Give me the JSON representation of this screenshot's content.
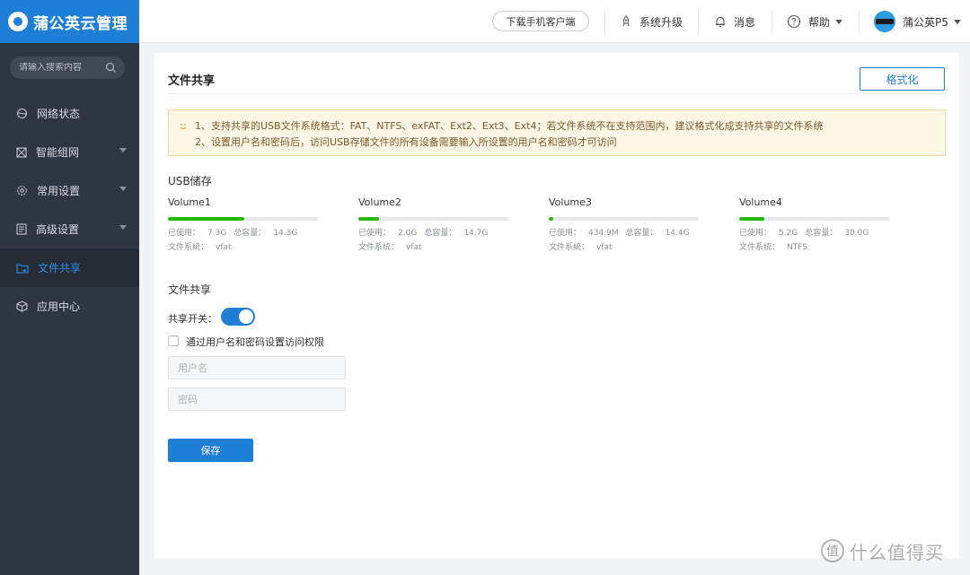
{
  "header": {
    "brand": "蒲公英云管理",
    "download_client": "下载手机客户端",
    "upgrade": "系统升级",
    "messages": "消息",
    "help": "帮助",
    "device": "蒲公英P5"
  },
  "sidebar": {
    "search_placeholder": "请输入搜索内容",
    "items": [
      {
        "label": "网络状态",
        "icon": "globe-icon",
        "expandable": false,
        "active": false
      },
      {
        "label": "智能组网",
        "icon": "network-icon",
        "expandable": true,
        "active": false
      },
      {
        "label": "常用设置",
        "icon": "gear-icon",
        "expandable": true,
        "active": false
      },
      {
        "label": "高级设置",
        "icon": "document-icon",
        "expandable": true,
        "active": false
      },
      {
        "label": "文件共享",
        "icon": "folder-share-icon",
        "expandable": false,
        "active": true
      },
      {
        "label": "应用中心",
        "icon": "cube-icon",
        "expandable": false,
        "active": false
      }
    ]
  },
  "main": {
    "title": "文件共享",
    "format_button": "格式化",
    "notice": [
      "1、支持共享的USB文件系统格式：FAT、NTFS、exFAT、Ext2、Ext3、Ext4；若文件系统不在支持范围内，建议格式化成支持共享的文件系统",
      "2、设置用户名和密码后，访问USB存储文件的所有设备需要输入所设置的用户名和密码才可访问"
    ],
    "usb_title": "USB储存",
    "labels": {
      "used": "已使用：",
      "total": "总容量：",
      "fs": "文件系统："
    },
    "volumes": [
      {
        "name": "Volume1",
        "used": "7.3G",
        "total": "14.3G",
        "fs": "vfat",
        "usage": 0.51
      },
      {
        "name": "Volume2",
        "used": "2.0G",
        "total": "14.7G",
        "fs": "vfat",
        "usage": 0.14
      },
      {
        "name": "Volume3",
        "used": "434.9M",
        "total": "14.4G",
        "fs": "vfat",
        "usage": 0.03
      },
      {
        "name": "Volume4",
        "used": "5.2G",
        "total": "30.0G",
        "fs": "NTFS",
        "usage": 0.17
      }
    ],
    "share_title": "文件共享",
    "share_switch_label": "共享开关：",
    "share_enabled": true,
    "auth_checkbox_label": "通过用户名和密码设置访问权限",
    "auth_enabled": false,
    "username_placeholder": "用户名",
    "username_value": "",
    "password_placeholder": "密码",
    "password_value": "",
    "save_button": "保存"
  },
  "watermark": {
    "badge": "值",
    "text": "什么值得买"
  },
  "colors": {
    "brand": "#1f7fd6",
    "sidebar": "#2e3641",
    "progress": "#27b90f",
    "notice_bg": "#fdf6e4"
  }
}
